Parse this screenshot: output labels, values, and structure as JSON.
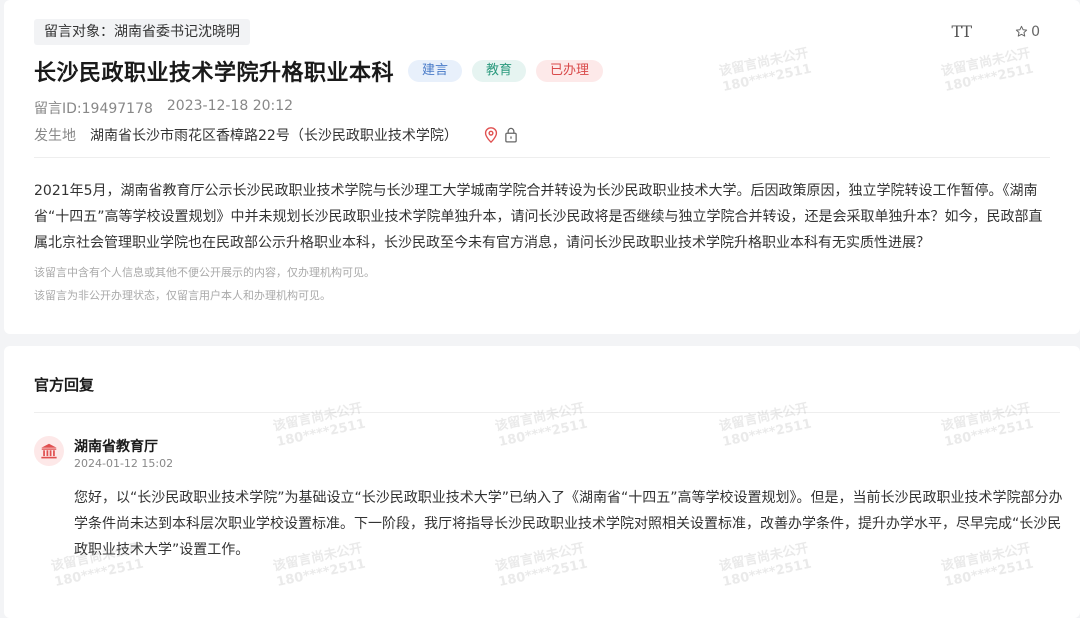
{
  "header": {
    "target_tag": "留言对象：湖南省委书记沈晓明",
    "font_size_icon": "TT",
    "favorite_count": "0"
  },
  "message": {
    "title": "长沙民政职业技术学院升格职业本科",
    "badges": [
      "建言",
      "教育",
      "已办理"
    ],
    "id_text": "留言ID:19497178",
    "datetime": "2023-12-18 20:12",
    "address_label": "发生地",
    "address_value": "湖南省长沙市雨花区香樟路22号（长沙民政职业技术学院）",
    "content": "2021年5月，湖南省教育厅公示长沙民政职业技术学院与长沙理工大学城南学院合并转设为长沙民政职业技术大学。后因政策原因，独立学院转设工作暂停。《湖南省“十四五”高等学校设置规划》中并未规划长沙民政职业技术学院单独升本，请问长沙民政将是否继续与独立学院合并转设，还是会采取单独升本？如今，民政部直属北京社会管理职业学院也在民政部公示升格职业本科，长沙民政至今未有官方消息，请问长沙民政职业技术学院升格职业本科有无实质性进展？",
    "notice_1": "该留言中含有个人信息或其他不便公开展示的内容，仅办理机构可见。",
    "notice_2": "该留言为非公开办理状态，仅留言用户本人和办理机构可见。"
  },
  "reply": {
    "heading": "官方回复",
    "department": "湖南省教育厅",
    "date": "2024-01-12 15:02",
    "content": "您好，以“长沙民政职业技术学院”为基础设立“长沙民政职业技术大学”已纳入了《湖南省“十四五”高等学校设置规划》。但是，当前长沙民政职业技术学院部分办学条件尚未达到本科层次职业学校设置标准。下一阶段，我厅将指导长沙民政职业技术学院对照相关设置标准，改善办学条件，提升办学水平，尽早完成“长沙民政职业技术大学”设置工作。"
  },
  "watermark": {
    "line1": "该留言尚未公开",
    "line2": "180****2511"
  },
  "icons": {
    "font_size": "font-size-icon",
    "star": "star-icon",
    "location": "location-pin-icon",
    "lock": "lock-icon",
    "department": "government-building-icon"
  },
  "colors": {
    "badge_advice": "#4a7bc8",
    "badge_education": "#2c9a7e",
    "badge_done": "#d94a4a",
    "location_pin": "#e05050"
  }
}
